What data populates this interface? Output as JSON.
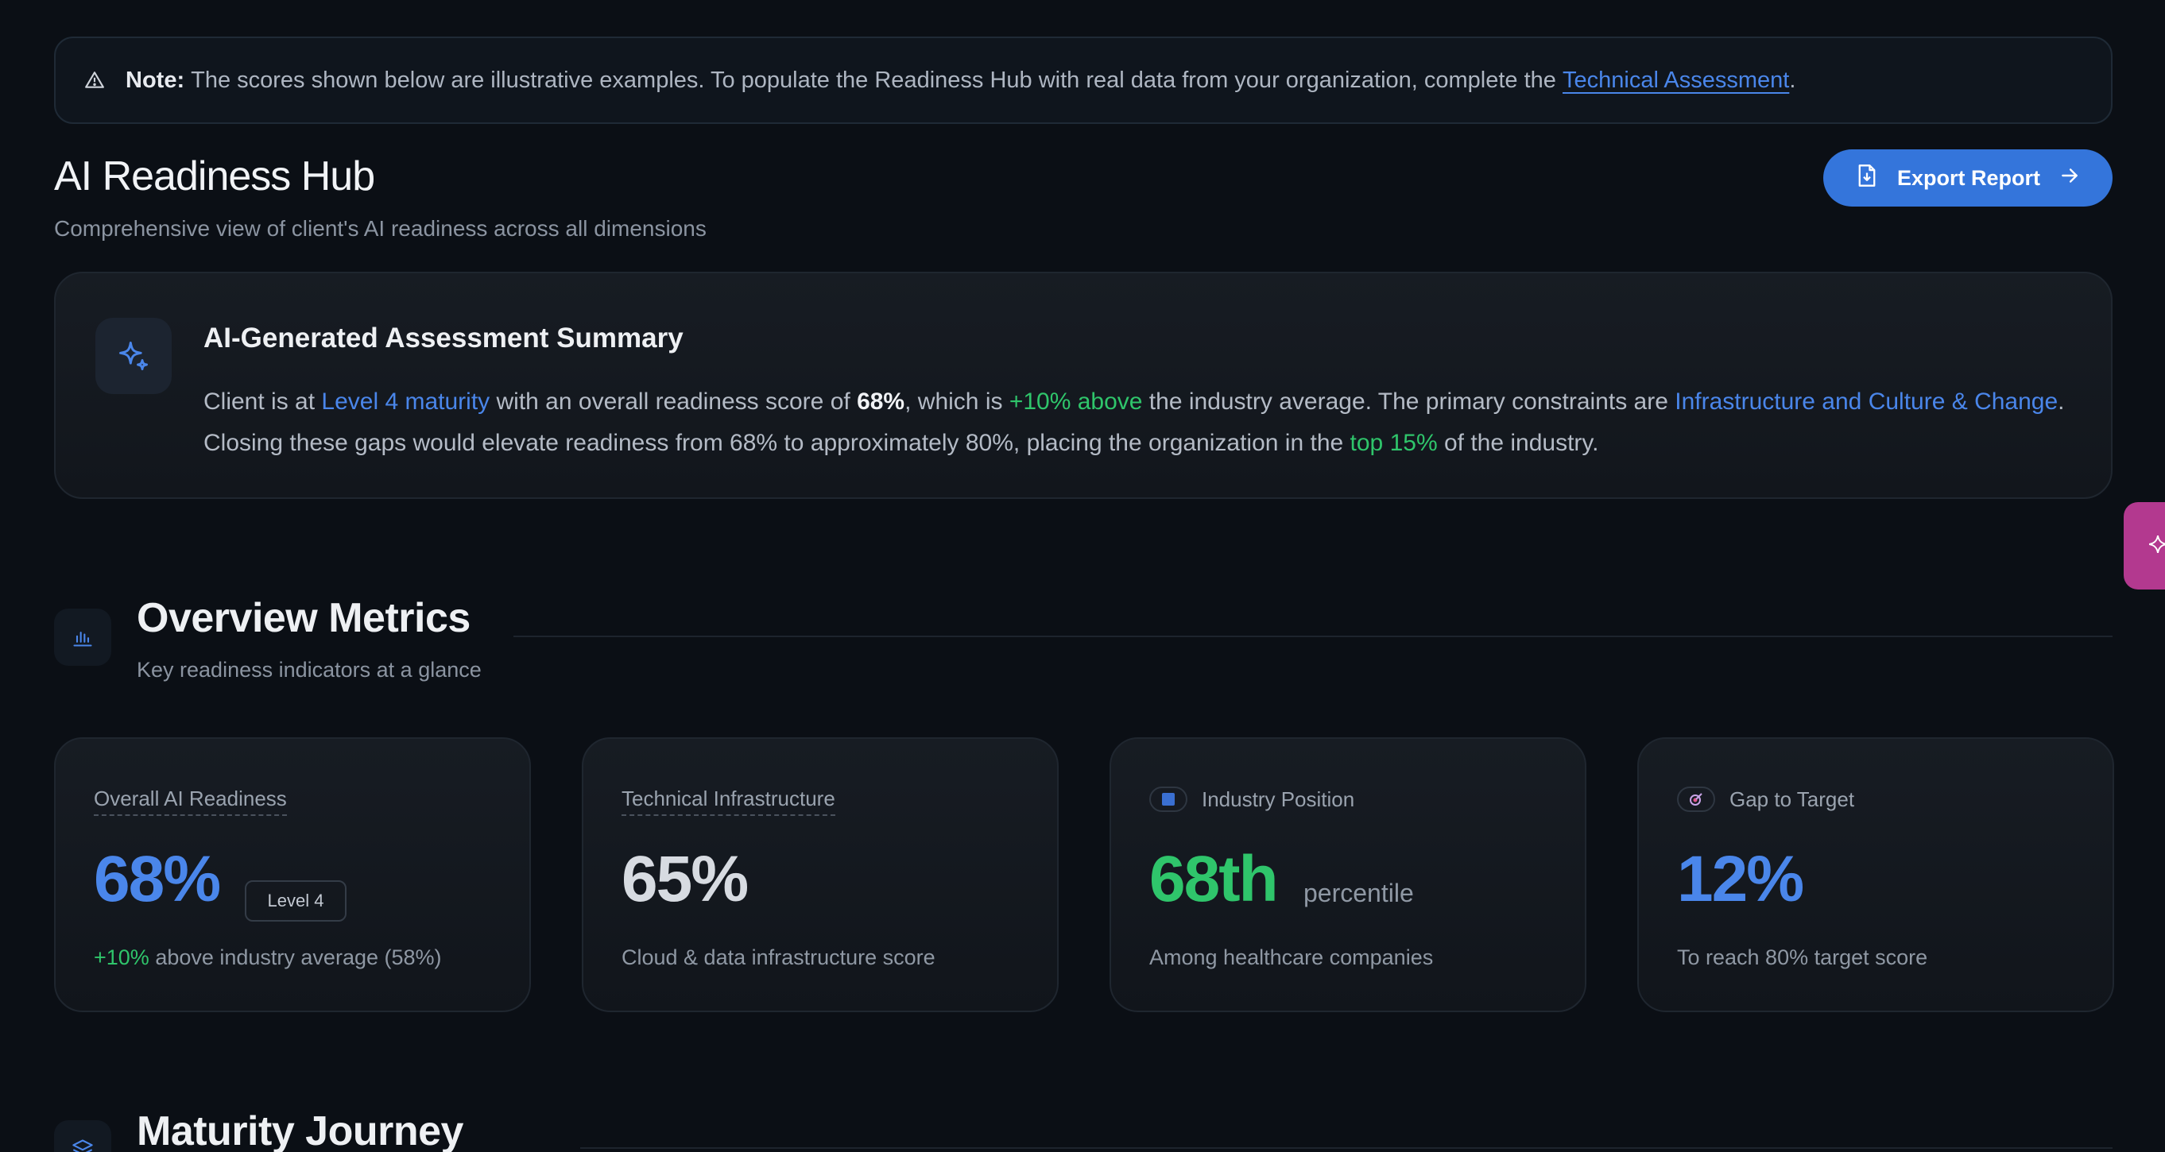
{
  "notice": {
    "label": "Note:",
    "text": "The scores shown below are illustrative examples. To populate the Readiness Hub with real data from your organization, complete the",
    "link": "Technical Assessment",
    "end": "."
  },
  "header": {
    "title": "AI Readiness Hub",
    "subtitle": "Comprehensive view of client's AI readiness across all dimensions",
    "export_label": "Export Report"
  },
  "summary": {
    "title": "AI-Generated Assessment Summary",
    "p1": "Client is at ",
    "maturity": "Level 4 maturity",
    "p2": " with an overall readiness score of ",
    "score": "68%",
    "p3": ", which is ",
    "delta": "+10% above",
    "p4": " the industry average. The primary constraints are ",
    "constraints": "Infrastructure and Culture & Change",
    "p5": ". Closing these gaps would elevate readiness from 68% to approximately 80%, placing the organization in the ",
    "top": "top 15%",
    "p6": " of the industry."
  },
  "overview": {
    "title": "Overview Metrics",
    "subtitle": "Key readiness indicators at a glance"
  },
  "cards": [
    {
      "label": "Overall AI Readiness",
      "value": "68%",
      "badge": "Level 4",
      "delta": "+10%",
      "foot": " above industry average (58%)",
      "color": "#4a86ea"
    },
    {
      "label": "Technical Infrastructure",
      "value": "65%",
      "foot": "Cloud & data infrastructure score",
      "color": "#d7dbe1"
    },
    {
      "label": "Industry Position",
      "value": "68th",
      "unit": "percentile",
      "foot": "Among healthcare companies",
      "color": "#2fc56b"
    },
    {
      "label": "Gap to Target",
      "value": "12%",
      "foot": "To reach 80% target score",
      "color": "#4a86ea"
    }
  ],
  "maturity": {
    "title": "Maturity Journey"
  }
}
